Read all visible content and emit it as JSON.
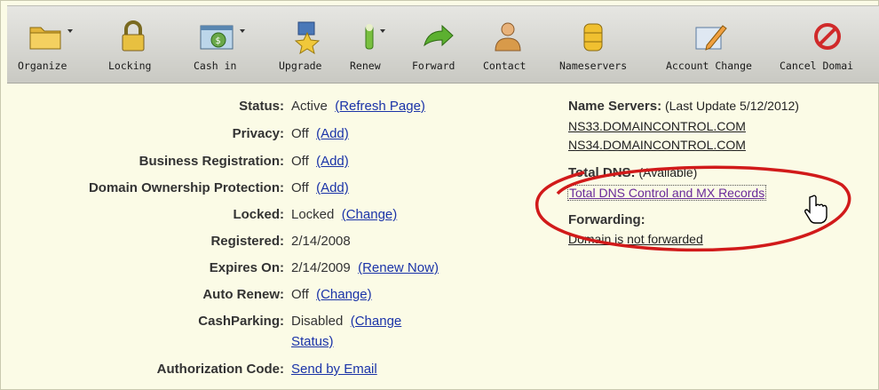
{
  "toolbar": {
    "items": [
      {
        "label": "Organize",
        "icon": "folder-icon"
      },
      {
        "label": "Locking",
        "icon": "lock-icon"
      },
      {
        "label": "Cash in",
        "icon": "cash-icon"
      },
      {
        "label": "Upgrade",
        "icon": "upgrade-icon"
      },
      {
        "label": "Renew",
        "icon": "renew-icon"
      },
      {
        "label": "Forward",
        "icon": "forward-arrow-icon"
      },
      {
        "label": "Contact",
        "icon": "contact-person-icon"
      },
      {
        "label": "Nameservers",
        "icon": "database-icon"
      },
      {
        "label": "Account Change",
        "icon": "account-change-icon"
      },
      {
        "label": "Cancel Domai",
        "icon": "cancel-icon"
      }
    ]
  },
  "details": {
    "status": {
      "label": "Status:",
      "value": "Active",
      "link": "(Refresh Page)"
    },
    "privacy": {
      "label": "Privacy:",
      "value": "Off",
      "link": "(Add)"
    },
    "business_registration": {
      "label": "Business Registration:",
      "value": "Off",
      "link": "(Add)"
    },
    "ownership_protection": {
      "label": "Domain Ownership Protection:",
      "value": "Off",
      "link": "(Add)"
    },
    "locked": {
      "label": "Locked:",
      "value": "Locked",
      "link": "(Change)"
    },
    "registered": {
      "label": "Registered:",
      "value": "2/14/2008"
    },
    "expires_on": {
      "label": "Expires On:",
      "value": "2/14/2009",
      "link": "(Renew Now)"
    },
    "auto_renew": {
      "label": "Auto Renew:",
      "value": "Off",
      "link": "(Change)"
    },
    "cash_parking": {
      "label": "CashParking:",
      "value": "Disabled",
      "link_line1": "(Change",
      "link_line2": "Status)"
    },
    "authorization_code": {
      "label": "Authorization Code:",
      "link": "Send by Email"
    }
  },
  "right_panel": {
    "name_servers_label": "Name Servers:",
    "name_servers_update": "(Last Update 5/12/2012)",
    "ns1": "NS33.DOMAINCONTROL.COM",
    "ns2": "NS34.DOMAINCONTROL.COM",
    "total_dns_label": "Total DNS:",
    "total_dns_status": "(Available)",
    "total_dns_link": "Total DNS Control and MX Records",
    "forwarding_label": "Forwarding:",
    "forwarding_link": "Domain is not forwarded"
  },
  "colors": {
    "highlight_ellipse": "#d11a1a",
    "link": "#1a33a8"
  }
}
